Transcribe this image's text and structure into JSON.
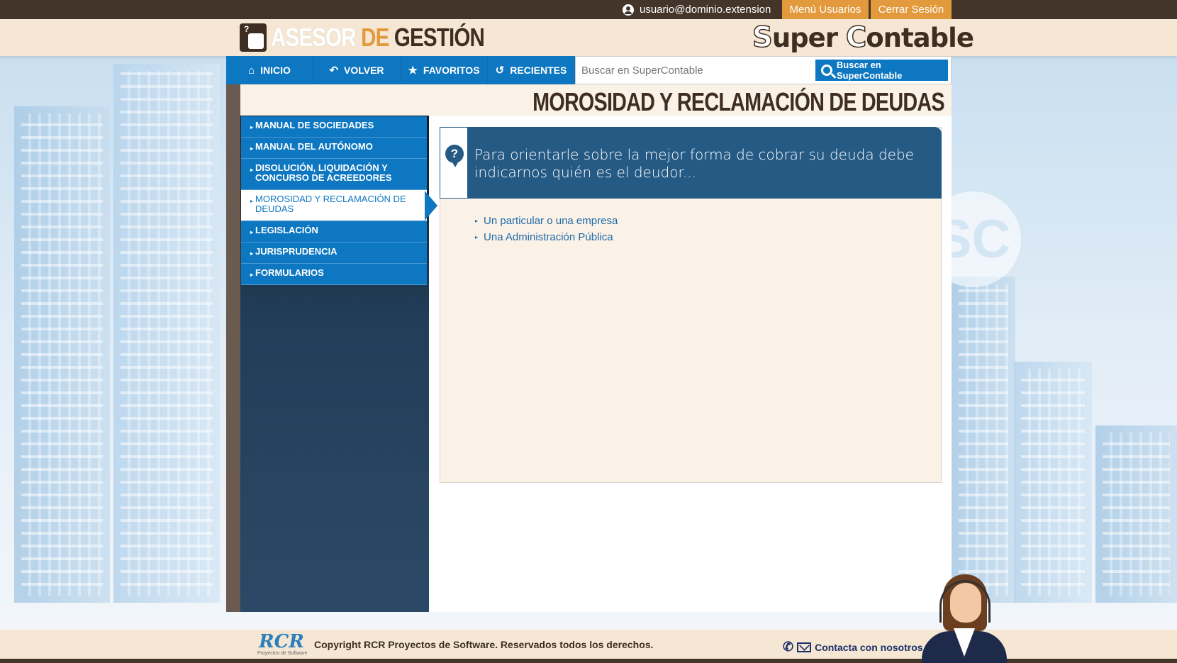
{
  "topbar": {
    "user_email": "usuario@dominio.extension",
    "menu_label": "Menú Usuarios",
    "logout_label": "Cerrar Sesión"
  },
  "header": {
    "logo_part1": "ASESOR",
    "logo_part2": "DE",
    "logo_part3": "GESTIÓN",
    "brand_s": "S",
    "brand_uper": "uper",
    "brand_c": "C",
    "brand_ontable": "ontable"
  },
  "nav": {
    "items": [
      {
        "label": "INICIO",
        "icon": "home-icon"
      },
      {
        "label": "VOLVER",
        "icon": "back-icon"
      },
      {
        "label": "FAVORITOS",
        "icon": "star-icon"
      },
      {
        "label": "RECIENTES",
        "icon": "history-icon"
      }
    ],
    "search_placeholder": "Buscar en SuperContable",
    "search_button": "Buscar en SuperContable"
  },
  "page_title": "MOROSIDAD Y RECLAMACIÓN DE DEUDAS",
  "sidebar": {
    "items": [
      {
        "label": "MANUAL DE SOCIEDADES"
      },
      {
        "label": "MANUAL DEL AUTÓNOMO"
      },
      {
        "label": "DISOLUCIÓN, LIQUIDACIÓN Y CONCURSO DE ACREEDORES"
      },
      {
        "label": "MOROSIDAD Y RECLAMACIÓN DE DEUDAS",
        "active": true
      },
      {
        "label": "LEGISLACIÓN"
      },
      {
        "label": "JURISPRUDENCIA"
      },
      {
        "label": "FORMULARIOS"
      }
    ]
  },
  "content": {
    "question": "Para orientarle sobre la mejor forma de cobrar su deuda debe indicarnos quién es el deudor...",
    "options": [
      "Un particular o una empresa",
      "Una Administración Pública"
    ]
  },
  "footer": {
    "logo": "RCR",
    "logo_sub": "Proyectos de Software",
    "copyright": "Copyright RCR Proyectos de Software. Reservados todos los derechos.",
    "contact": "Contacta con nosotros"
  },
  "colors": {
    "dark_brown": "#44352a",
    "orange": "#e39a3c",
    "blue": "#0d77c2",
    "navy": "#255a85",
    "cream": "#faf1e7"
  }
}
